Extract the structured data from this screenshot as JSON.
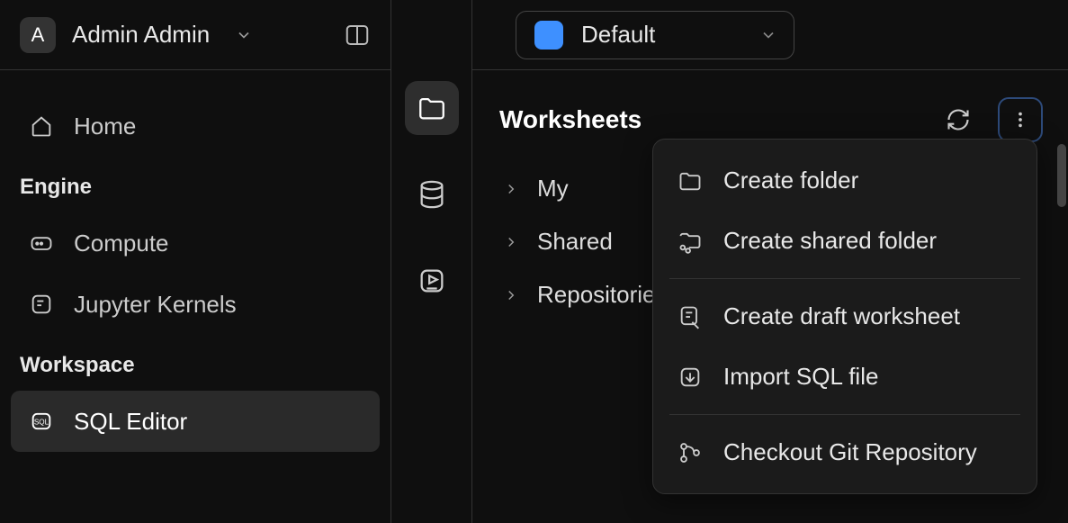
{
  "header": {
    "avatar_initial": "A",
    "username": "Admin Admin"
  },
  "nav": {
    "home": "Home",
    "section_engine": "Engine",
    "compute": "Compute",
    "jupyter": "Jupyter Kernels",
    "section_workspace": "Workspace",
    "sql_editor": "SQL Editor"
  },
  "picker": {
    "label": "Default"
  },
  "worksheets": {
    "title": "Worksheets",
    "items": [
      "My",
      "Shared",
      "Repositories"
    ]
  },
  "menu": {
    "create_folder": "Create folder",
    "create_shared_folder": "Create shared folder",
    "create_draft": "Create draft worksheet",
    "import_sql": "Import SQL file",
    "checkout_git": "Checkout Git Repository"
  }
}
